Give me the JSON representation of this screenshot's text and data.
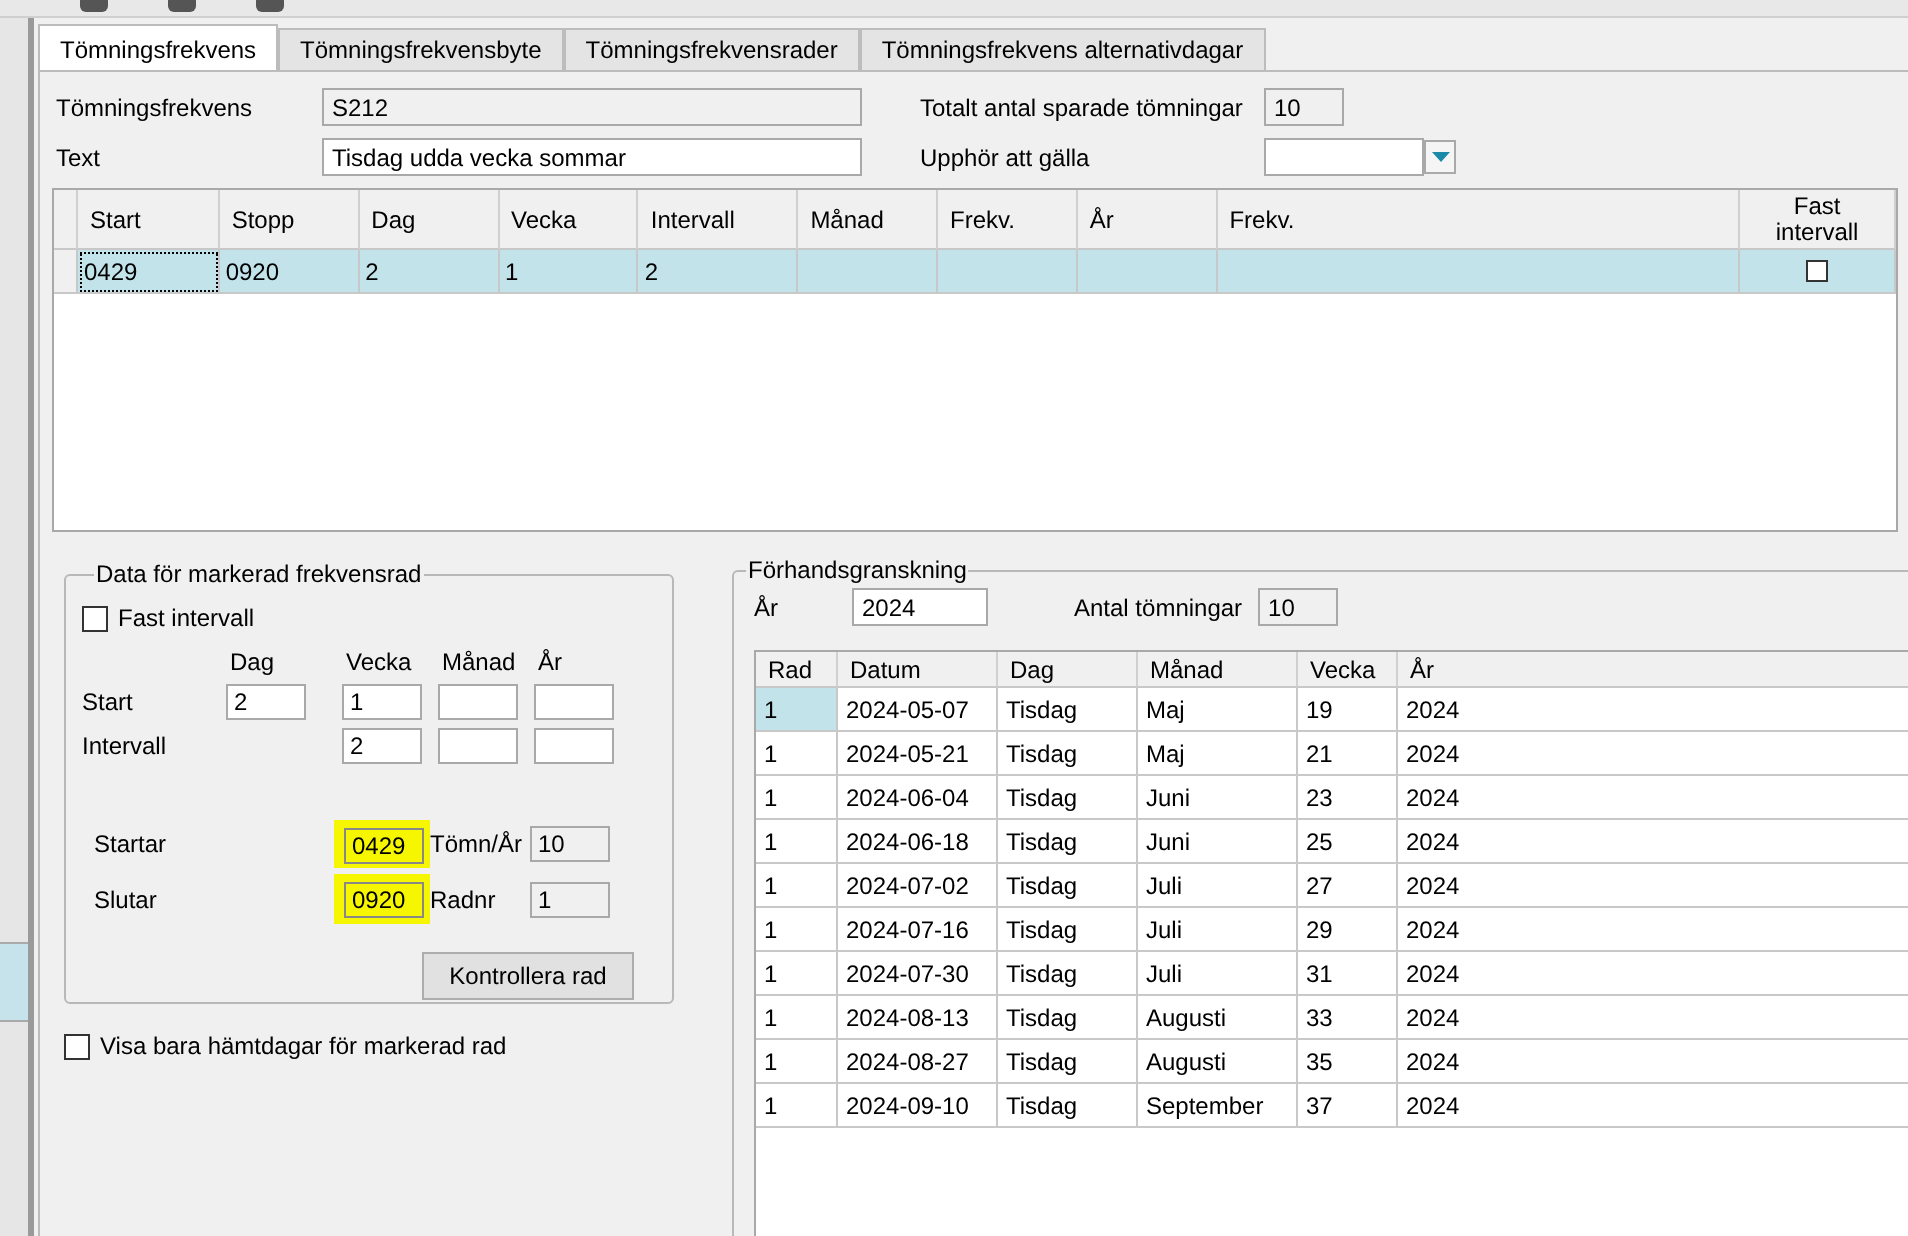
{
  "tabs": [
    {
      "label": "Tömningsfrekvens",
      "selected": true
    },
    {
      "label": "Tömningsfrekvensbyte",
      "selected": false
    },
    {
      "label": "Tömningsfrekvensrader",
      "selected": false
    },
    {
      "label": "Tömningsfrekvens alternativdagar",
      "selected": false
    }
  ],
  "form": {
    "frequency": {
      "label": "Tömningsfrekvens",
      "value": "S212",
      "disabled": true
    },
    "text": {
      "label": "Text",
      "value": "Tisdag udda vecka sommar",
      "disabled": false
    },
    "total_saved": {
      "label": "Totalt antal sparade tömningar",
      "value": "10",
      "disabled": true
    },
    "expires": {
      "label": "Upphör att gälla"
    }
  },
  "grid": {
    "columns": [
      "Start",
      "Stopp",
      "Dag",
      "Vecka",
      "Intervall",
      "Månad",
      "Frekv.",
      "År",
      "Frekv.",
      "Fast intervall"
    ],
    "rows": [
      {
        "cells": [
          "0429",
          "0920",
          "2",
          "1",
          "2",
          null,
          null,
          null,
          null
        ],
        "fast_intervall": false,
        "selected": true
      }
    ]
  },
  "detail": {
    "title": "Data för markerad frekvensrad",
    "fast_intervall": {
      "label": "Fast intervall",
      "checked": false
    },
    "columns": [
      "Dag",
      "Vecka",
      "Månad",
      "År"
    ],
    "rows": [
      {
        "label": "Start",
        "fields": [
          {
            "kind": "input",
            "value": "2"
          },
          {
            "kind": "input",
            "value": "1"
          },
          {
            "kind": "input"
          },
          {
            "kind": "input"
          }
        ]
      },
      {
        "label": "Intervall",
        "fields": [
          {
            "kind": "none"
          },
          {
            "kind": "input",
            "value": "2"
          },
          {
            "kind": "input"
          },
          {
            "kind": "input"
          }
        ]
      }
    ],
    "range": [
      {
        "label": "Startar",
        "value": "0429",
        "highlighted": true,
        "side_label": "Tömn/År",
        "side_value": "10"
      },
      {
        "label": "Slutar",
        "value": "0920",
        "highlighted": true,
        "side_label": "Radnr",
        "side_value": "1"
      }
    ],
    "button": "Kontrollera rad"
  },
  "only_pickup_days": {
    "label": "Visa bara hämtdagar för markerad rad",
    "checked": false
  },
  "preview": {
    "title": "Förhandsgranskning",
    "year": {
      "label": "År",
      "value": "2024"
    },
    "count": {
      "label": "Antal tömningar",
      "value": "10"
    },
    "columns": [
      "Rad",
      "Datum",
      "Dag",
      "Månad",
      "Vecka",
      "År"
    ],
    "rows": [
      {
        "cells": [
          "1",
          "2024-05-07",
          "Tisdag",
          "Maj",
          "19",
          "2024"
        ],
        "selected": true
      },
      {
        "cells": [
          "1",
          "2024-05-21",
          "Tisdag",
          "Maj",
          "21",
          "2024"
        ],
        "selected": false
      },
      {
        "cells": [
          "1",
          "2024-06-04",
          "Tisdag",
          "Juni",
          "23",
          "2024"
        ],
        "selected": false
      },
      {
        "cells": [
          "1",
          "2024-06-18",
          "Tisdag",
          "Juni",
          "25",
          "2024"
        ],
        "selected": false
      },
      {
        "cells": [
          "1",
          "2024-07-02",
          "Tisdag",
          "Juli",
          "27",
          "2024"
        ],
        "selected": false
      },
      {
        "cells": [
          "1",
          "2024-07-16",
          "Tisdag",
          "Juli",
          "29",
          "2024"
        ],
        "selected": false
      },
      {
        "cells": [
          "1",
          "2024-07-30",
          "Tisdag",
          "Juli",
          "31",
          "2024"
        ],
        "selected": false
      },
      {
        "cells": [
          "1",
          "2024-08-13",
          "Tisdag",
          "Augusti",
          "33",
          "2024"
        ],
        "selected": false
      },
      {
        "cells": [
          "1",
          "2024-08-27",
          "Tisdag",
          "Augusti",
          "35",
          "2024"
        ],
        "selected": false
      },
      {
        "cells": [
          "1",
          "2024-09-10",
          "Tisdag",
          "September",
          "37",
          "2024"
        ],
        "selected": false
      }
    ]
  }
}
